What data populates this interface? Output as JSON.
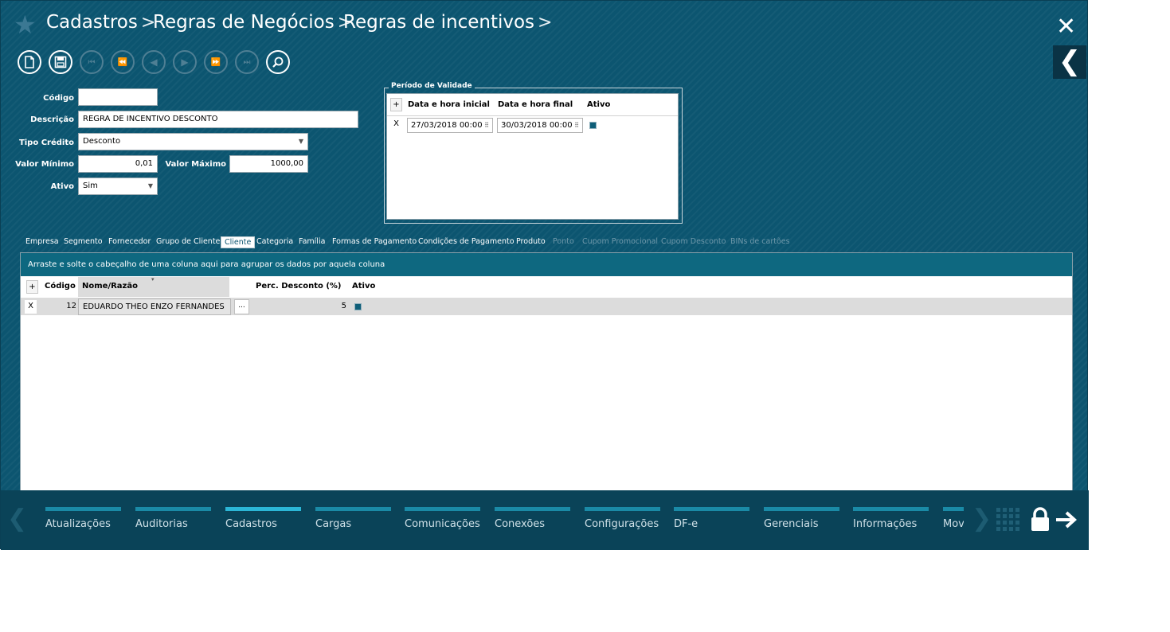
{
  "breadcrumb": [
    {
      "label": "Cadastros",
      "sep": ">"
    },
    {
      "label": "Regras de Negócios",
      "sep": ">"
    },
    {
      "label": "Regras de incentivos",
      "sep": ">"
    }
  ],
  "form": {
    "codigo_label": "Código",
    "codigo_value": "",
    "descricao_label": "Descrição",
    "descricao_value": "REGRA DE INCENTIVO DESCONTO",
    "tipo_credito_label": "Tipo Crédito",
    "tipo_credito_value": "Desconto",
    "valor_minimo_label": "Valor Mínimo",
    "valor_minimo_value": "0,01",
    "valor_maximo_label": "Valor Máximo",
    "valor_maximo_value": "1000,00",
    "ativo_label": "Ativo",
    "ativo_value": "Sim"
  },
  "periodo": {
    "legend": "Período de Validade",
    "add_label": "+",
    "col_inicial": "Data e hora inicial",
    "col_final": "Data e hora final",
    "col_ativo": "Ativo",
    "rows": [
      {
        "remove_label": "X",
        "inicial": "27/03/2018 00:00",
        "final": "30/03/2018 00:00",
        "ativo": true
      }
    ]
  },
  "tabs": [
    {
      "label": "Empresa",
      "state": "normal"
    },
    {
      "label": "Segmento",
      "state": "normal"
    },
    {
      "label": "Fornecedor",
      "state": "normal"
    },
    {
      "label": "Grupo de Cliente",
      "state": "normal"
    },
    {
      "label": "Cliente",
      "state": "active"
    },
    {
      "label": "Categoria",
      "state": "normal"
    },
    {
      "label": "Família",
      "state": "normal"
    },
    {
      "label": "Formas de Pagamento",
      "state": "normal"
    },
    {
      "label": "Condições de Pagamento",
      "state": "normal"
    },
    {
      "label": "Produto",
      "state": "normal"
    },
    {
      "label": "Ponto",
      "state": "disabled"
    },
    {
      "label": "Cupom Promocional",
      "state": "disabled"
    },
    {
      "label": "Cupom Desconto",
      "state": "disabled"
    },
    {
      "label": "BINs de cartões",
      "state": "disabled"
    }
  ],
  "grid": {
    "group_hint": "Arraste e solte o cabeçalho de uma coluna aqui para agrupar os dados por aquela coluna",
    "add_label": "+",
    "col_codigo": "Código",
    "col_nome": "Nome/Razão",
    "col_perc": "Perc. Desconto (%)",
    "col_ativo": "Ativo",
    "rows": [
      {
        "remove_label": "X",
        "codigo": "12",
        "nome": "EDUARDO THEO ENZO FERNANDES",
        "lookup_label": "...",
        "perc": "5",
        "ativo": true
      }
    ]
  },
  "bottom_menu": [
    {
      "label": "Atualizações",
      "active": false
    },
    {
      "label": "Auditorias",
      "active": false
    },
    {
      "label": "Cadastros",
      "active": true
    },
    {
      "label": "Cargas",
      "active": false
    },
    {
      "label": "Comunicações",
      "active": false
    },
    {
      "label": "Conexões",
      "active": false
    },
    {
      "label": "Configurações",
      "active": false
    },
    {
      "label": "DF-e",
      "active": false
    },
    {
      "label": "Gerenciais",
      "active": false
    },
    {
      "label": "Informações",
      "active": false
    },
    {
      "label": "Mov",
      "active": false
    }
  ],
  "icons": {
    "favorite": "star-icon",
    "close": "close-icon",
    "back": "chevron-left-icon",
    "new": "new-document-icon",
    "save": "save-icon",
    "first": "first-record-icon",
    "prev_page": "rewind-icon",
    "prev": "previous-icon",
    "next": "next-icon",
    "next_page": "fast-forward-icon",
    "last": "last-record-icon",
    "search": "search-icon",
    "apps": "apps-grid-icon",
    "lock": "lock-icon",
    "logout": "arrow-right-icon"
  },
  "colors": {
    "background": "#0c5570",
    "accent": "#2bb6d6",
    "active_check": "#0f5e78"
  }
}
